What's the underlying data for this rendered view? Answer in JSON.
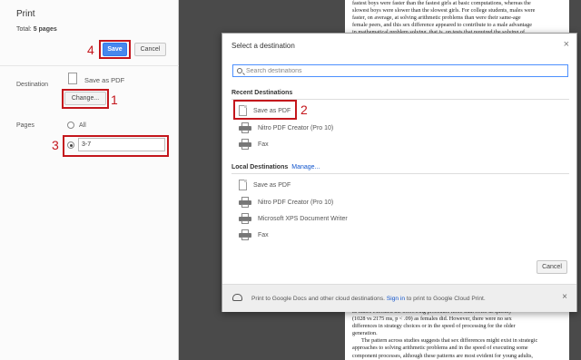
{
  "print_panel": {
    "title": "Print",
    "total_label": "Total: ",
    "total_value": "5 pages",
    "save_label": "Save",
    "cancel_label": "Cancel",
    "destination_label": "Destination",
    "destination_value": "Save as PDF",
    "change_label": "Change...",
    "pages_label": "Pages",
    "pages_all_label": "All",
    "pages_custom_value": "3-7"
  },
  "callouts": [
    "1",
    "2",
    "3",
    "4"
  ],
  "dialog": {
    "title": "Select a destination",
    "close_glyph": "×",
    "search_placeholder": "Search destinations",
    "recent_heading": "Recent Destinations",
    "recent_items": [
      {
        "name": "Save as PDF",
        "icon": "pdf-icon"
      },
      {
        "name": "Nitro PDF Creator (Pro 10)",
        "icon": "printer-icon"
      },
      {
        "name": "Fax",
        "icon": "printer-icon"
      }
    ],
    "local_heading": "Local Destinations",
    "manage_label": "Manage...",
    "local_items": [
      {
        "name": "Save as PDF",
        "icon": "pdf-icon"
      },
      {
        "name": "Nitro PDF Creator (Pro 10)",
        "icon": "printer-icon"
      },
      {
        "name": "Microsoft XPS Document Writer",
        "icon": "printer-icon"
      },
      {
        "name": "Fax",
        "icon": "printer-icon"
      }
    ],
    "cancel_label": "Cancel",
    "footer_prefix": "Print to Google Docs and other cloud destinations.",
    "footer_link": "Sign in",
    "footer_suffix": "to print to Google Cloud Print.",
    "footer_close_glyph": "×"
  },
  "document": {
    "top_lines": [
      "fastest boys were faster than the fastest girls at basic computations, whereas the",
      "slowest boys were slower than the slowest girls. For college students, males were",
      "faster, on average, at solving arithmetic problems than were their same-age",
      "female peers, and this sex difference appeared to contribute to a male advantage",
      "in mathematical problem solving, that is, on tests that required the solving of"
    ],
    "bottom_lines": [
      "as males executed the borrowing procedure more than twice as quickly",
      "(1028 vs 2175 ms, p < .09) as females did. However, there were no sex",
      "differences in strategy choices or in the speed of processing for the older",
      "generation.",
      "The pattern across studies suggests that sex differences might exist in strategic",
      "approaches to solving arithmetic problems and in the speed of executing some",
      "component processes, although these patterns are most evident for young adults,"
    ]
  },
  "colors": {
    "accent": "#4787ed",
    "callout": "#c4161c",
    "link": "#1155cc",
    "preview_bg": "#4a4a4a"
  }
}
